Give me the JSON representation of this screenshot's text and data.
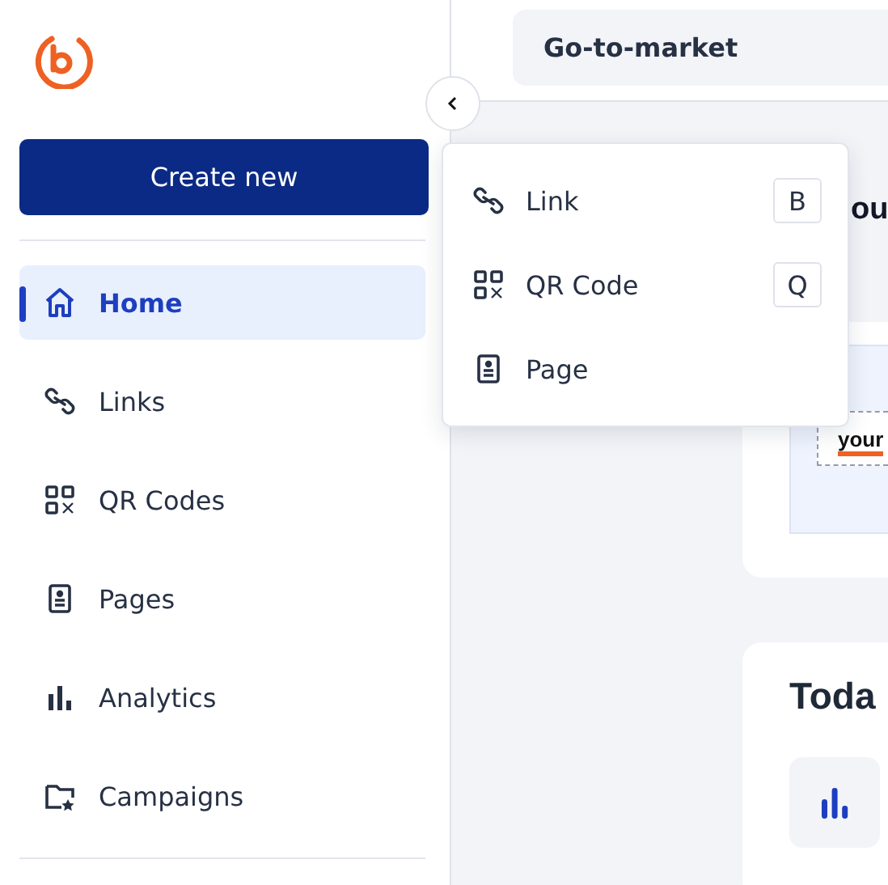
{
  "sidebar": {
    "create_button": "Create new",
    "items": [
      {
        "label": "Home",
        "kind": "home",
        "selected": true
      },
      {
        "label": "Links",
        "kind": "link",
        "selected": false
      },
      {
        "label": "QR Codes",
        "kind": "qr",
        "selected": false
      },
      {
        "label": "Pages",
        "kind": "page",
        "selected": false
      },
      {
        "label": "Analytics",
        "kind": "analytics",
        "selected": false
      },
      {
        "label": "Campaigns",
        "kind": "campaign",
        "selected": false
      }
    ]
  },
  "header": {
    "workspace": "Go-to-market"
  },
  "main": {
    "heading": "ou",
    "preview_text": "your",
    "card_heading": "Toda"
  },
  "create_menu": {
    "items": [
      {
        "label": "Link",
        "kind": "link",
        "shortcut": "B"
      },
      {
        "label": "QR Code",
        "kind": "qr",
        "shortcut": "Q"
      },
      {
        "label": "Page",
        "kind": "page"
      }
    ]
  }
}
